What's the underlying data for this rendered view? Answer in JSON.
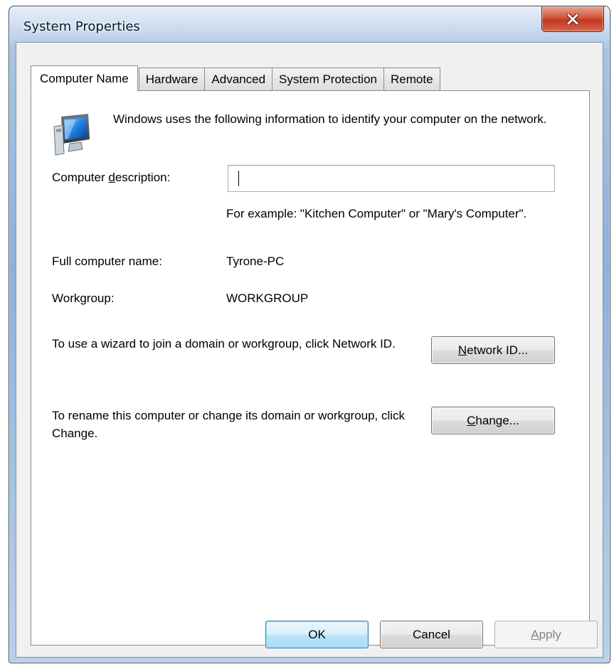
{
  "window": {
    "title": "System Properties"
  },
  "tabs": [
    {
      "label": "Computer Name",
      "active": true
    },
    {
      "label": "Hardware",
      "active": false
    },
    {
      "label": "Advanced",
      "active": false
    },
    {
      "label": "System Protection",
      "active": false
    },
    {
      "label": "Remote",
      "active": false
    }
  ],
  "computer_name": {
    "intro": "Windows uses the following information to identify your computer on the network.",
    "description_label_pre": "Computer ",
    "description_label_accel": "d",
    "description_label_post": "escription:",
    "description_value": "",
    "description_hint": "For example: \"Kitchen Computer\" or \"Mary's Computer\".",
    "full_name_label": "Full computer name:",
    "full_name_value": "Tyrone-PC",
    "workgroup_label": "Workgroup:",
    "workgroup_value": "WORKGROUP",
    "network_id_text": "To use a wizard to join a domain or workgroup, click Network ID.",
    "network_id_button_accel": "N",
    "network_id_button_rest": "etwork ID...",
    "change_text": "To rename this computer or change its domain or workgroup, click Change.",
    "change_button_accel": "C",
    "change_button_rest": "hange..."
  },
  "buttons": {
    "ok": "OK",
    "cancel": "Cancel",
    "apply_accel": "A",
    "apply_rest": "pply"
  },
  "icons": {
    "close": "close-icon",
    "computer": "computer-icon"
  },
  "colors": {
    "accent": "#3c7fb1",
    "close_button": "#c03a1f"
  }
}
